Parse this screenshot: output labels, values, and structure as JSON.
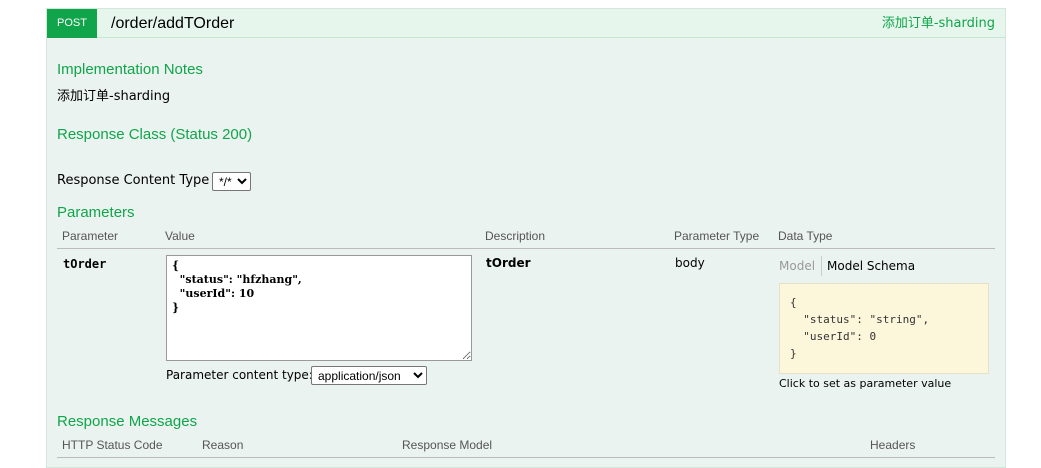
{
  "operation": {
    "method": "POST",
    "path": "/order/addTOrder",
    "summary": "添加订单-sharding"
  },
  "implementation_notes": {
    "title": "Implementation Notes",
    "text": "添加订单-sharding"
  },
  "response_class": {
    "title": "Response Class (Status 200)"
  },
  "response_content_type": {
    "label": "Response Content Type",
    "selected": "*/*"
  },
  "parameters": {
    "title": "Parameters",
    "columns": [
      "Parameter",
      "Value",
      "Description",
      "Parameter Type",
      "Data Type"
    ],
    "rows": [
      {
        "name": "tOrder",
        "value": "{\n  \"status\": \"hfzhang\",\n  \"userId\": 10\n}",
        "description": "tOrder",
        "param_type": "body",
        "model_tab": "Model",
        "schema_tab": "Model Schema",
        "schema": "{\n  \"status\": \"string\",\n  \"userId\": 0\n}",
        "schema_hint": "Click to set as parameter value",
        "content_type_label": "Parameter content type:",
        "content_type_selected": "application/json"
      }
    ]
  },
  "response_messages": {
    "title": "Response Messages",
    "columns": [
      "HTTP Status Code",
      "Reason",
      "Response Model",
      "Headers"
    ]
  },
  "colors": {
    "accent": "#10a54a",
    "op_background": "#ebf3f0",
    "schema_background": "#fcf6db"
  }
}
